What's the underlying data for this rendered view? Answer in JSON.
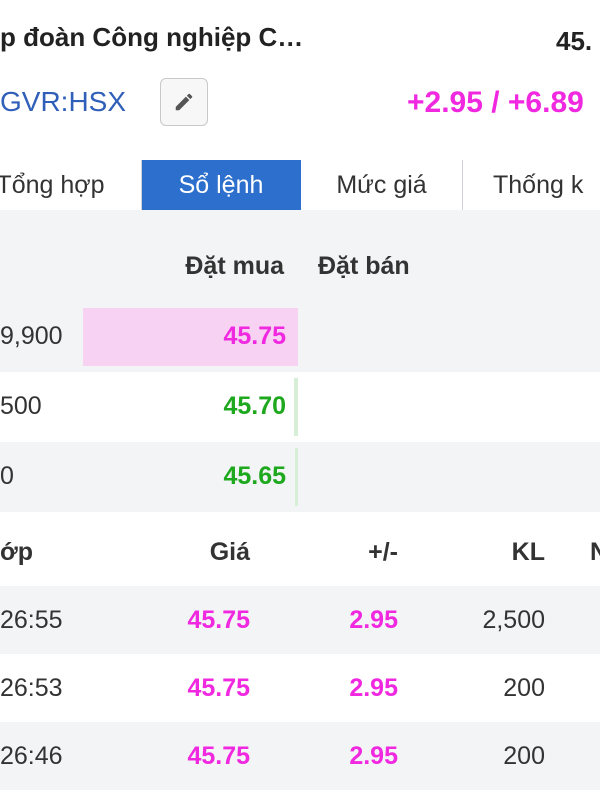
{
  "header": {
    "company_name": "p đoàn Công nghiệp C…",
    "price": "45.",
    "ticker": "GVR:HSX",
    "change": "+2.95 / +6.89",
    "edit_icon": "pencil-icon"
  },
  "tabs": [
    {
      "label": "Tổng hợp",
      "active": false
    },
    {
      "label": "Sổ lệnh",
      "active": true
    },
    {
      "label": "Mức giá",
      "active": false
    },
    {
      "label": "Thống k",
      "active": false
    }
  ],
  "orderbook": {
    "buy_label": "Đặt mua",
    "sell_label": "Đặt bán",
    "rows": [
      {
        "volume": "9,900",
        "price": "45.75",
        "price_color": "#f028e0",
        "bar_fraction": 1.0,
        "bar_color": "#f7d2f3"
      },
      {
        "volume": "500",
        "price": "45.70",
        "price_color": "#1ea81e",
        "bar_fraction": 0.02,
        "bar_color": "#d6efd6"
      },
      {
        "volume": "0",
        "price": "45.65",
        "price_color": "#1ea81e",
        "bar_fraction": 0.01,
        "bar_color": "#d6efd6"
      }
    ]
  },
  "trades": {
    "headers": {
      "time": "ớp",
      "price": "Giá",
      "change": "+/-",
      "volume": "KL",
      "extra": "N"
    },
    "rows": [
      {
        "time": "26:55",
        "price": "45.75",
        "change": "2.95",
        "volume": "2,500"
      },
      {
        "time": "26:53",
        "price": "45.75",
        "change": "2.95",
        "volume": "200"
      },
      {
        "time": "26:46",
        "price": "45.75",
        "change": "2.95",
        "volume": "200"
      }
    ]
  },
  "colors": {
    "up": "#f028e0",
    "buy_green": "#1ea81e",
    "tab_active": "#2d6fcd",
    "ticker_blue": "#2f5fb8"
  }
}
